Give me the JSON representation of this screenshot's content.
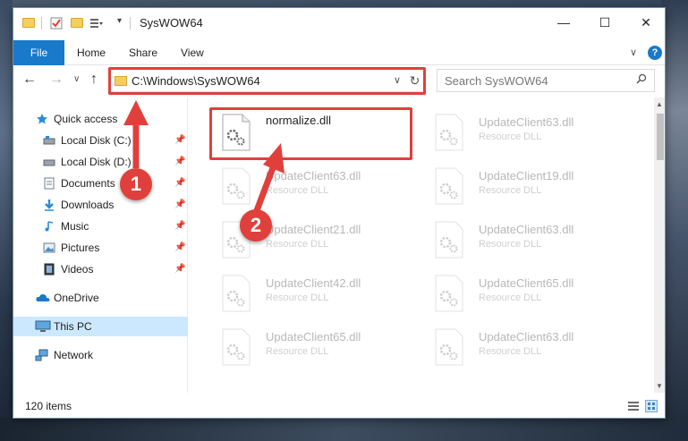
{
  "window": {
    "title": "SysWOW64"
  },
  "ribbon": {
    "tabs": [
      "File",
      "Home",
      "Share",
      "View"
    ]
  },
  "address": {
    "path": "C:\\Windows\\SysWOW64",
    "search_placeholder": "Search SysWOW64"
  },
  "nav": {
    "quick_access": "Quick access",
    "items": [
      {
        "label": "Local Disk (C:)",
        "icon": "drive-icon",
        "pinned": true
      },
      {
        "label": "Local Disk (D:)",
        "icon": "drive-icon",
        "pinned": true
      },
      {
        "label": "Documents",
        "icon": "documents-icon",
        "pinned": true
      },
      {
        "label": "Downloads",
        "icon": "downloads-icon",
        "pinned": true
      },
      {
        "label": "Music",
        "icon": "music-icon",
        "pinned": true
      },
      {
        "label": "Pictures",
        "icon": "pictures-icon",
        "pinned": true
      },
      {
        "label": "Videos",
        "icon": "videos-icon",
        "pinned": true
      }
    ],
    "onedrive": "OneDrive",
    "this_pc": "This PC",
    "network": "Network"
  },
  "files": [
    {
      "name": "normalize.dll",
      "type": "",
      "highlighted": true
    },
    {
      "name": "UpdateClient63.dll",
      "type": "Resource DLL"
    },
    {
      "name": "UpdateClient63.dll",
      "type": "Resource DLL"
    },
    {
      "name": "UpdateClient19.dll",
      "type": "Resource DLL"
    },
    {
      "name": "UpdateClient21.dll",
      "type": "Resource DLL"
    },
    {
      "name": "UpdateClient63.dll",
      "type": "Resource DLL"
    },
    {
      "name": "UpdateClient42.dll",
      "type": "Resource DLL"
    },
    {
      "name": "UpdateClient65.dll",
      "type": "Resource DLL"
    },
    {
      "name": "UpdateClient65.dll",
      "type": "Resource DLL"
    },
    {
      "name": "UpdateClient63.dll",
      "type": "Resource DLL"
    }
  ],
  "status": {
    "item_count": "120 items"
  },
  "callouts": {
    "step1": "1",
    "step2": "2"
  },
  "colors": {
    "accent": "#1979ca",
    "highlight": "#e0403c",
    "selected": "#cce8ff"
  }
}
